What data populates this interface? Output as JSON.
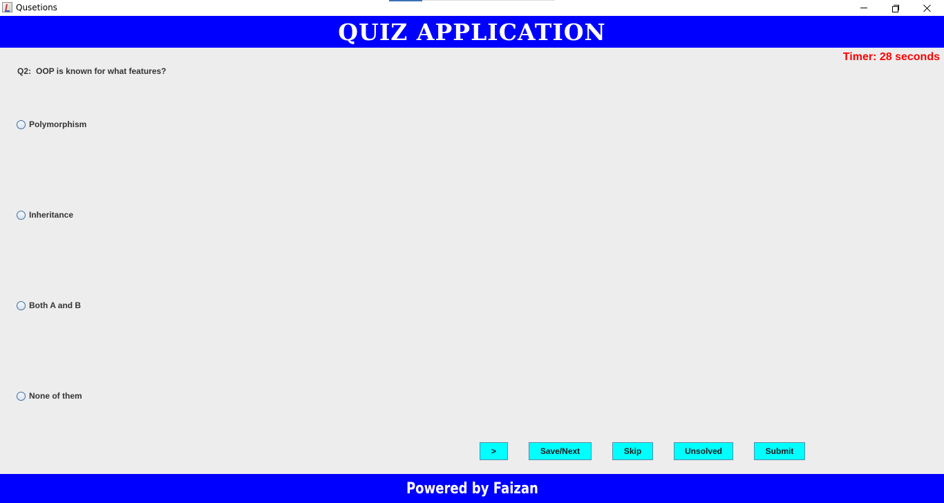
{
  "window": {
    "title": "Qusetions",
    "icon": "java-cup-icon",
    "controls": [
      "minimize-icon",
      "restore-icon",
      "close-icon"
    ]
  },
  "header": {
    "title": "QUIZ APPLICATION"
  },
  "timer": {
    "text": "Timer: 28 seconds"
  },
  "question": {
    "number": "Q2:",
    "text": "OOP is known for what features?"
  },
  "options": [
    {
      "label": "Polymorphism",
      "selected": false
    },
    {
      "label": "Inheritance",
      "selected": false
    },
    {
      "label": "Both A and B",
      "selected": false
    },
    {
      "label": "None of them",
      "selected": false
    }
  ],
  "buttons": {
    "prev": ">",
    "save_next": "Save/Next",
    "skip": "Skip",
    "unsolved": "Unsolved",
    "submit": "Submit"
  },
  "footer": {
    "text": "Powered by Faizan"
  },
  "colors": {
    "header_bg": "#0000ff",
    "header_text": "#ffffff",
    "timer_text": "#ff0000",
    "button_bg": "#00ffff",
    "panel_bg": "#ededed"
  }
}
